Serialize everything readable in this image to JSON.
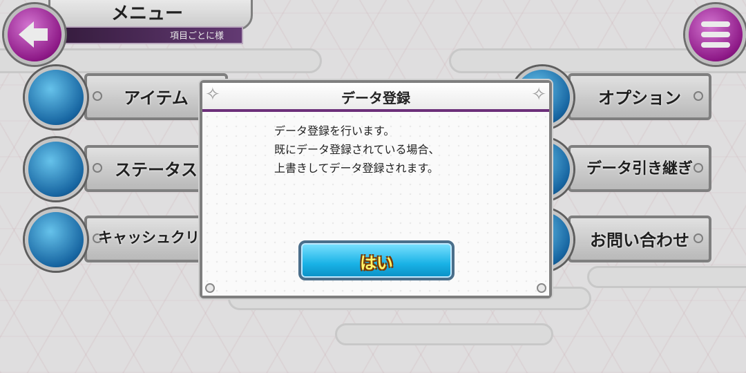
{
  "header": {
    "title": "メニュー",
    "subtitle": "項目ごとに様"
  },
  "menu": {
    "left": [
      {
        "label": "アイテム",
        "icon": "scroll-icon"
      },
      {
        "label": "ステータス",
        "icon": "list-icon"
      },
      {
        "label": "キャッシュクリア",
        "icon": "broom-icon"
      }
    ],
    "right": [
      {
        "label": "オプション",
        "icon": "gear-icon"
      },
      {
        "label": "データ引き継ぎ",
        "icon": "card-icon"
      },
      {
        "label": "お問い合わせ",
        "icon": "mail-icon"
      }
    ]
  },
  "dialog": {
    "title": "データ登録",
    "lines": [
      "データ登録を行います。",
      "既にデータ登録されている場合、",
      "上書きしてデータ登録されます。"
    ],
    "confirm_label": "はい"
  },
  "colors": {
    "accent_purple": "#9a1c93",
    "accent_blue": "#19b2e6",
    "button_text": "#fff36b"
  }
}
